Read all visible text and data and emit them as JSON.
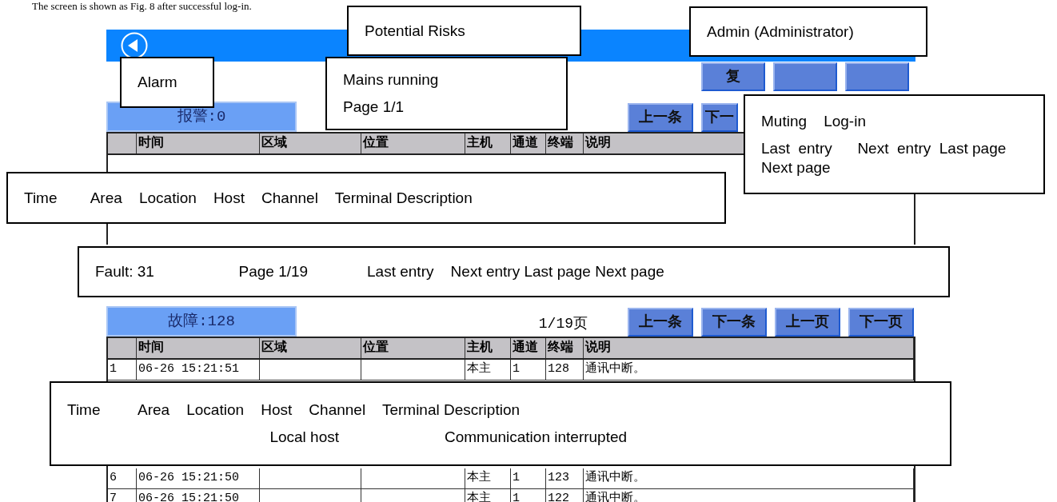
{
  "caption": "The screen is shown as Fig. 8 after successful log-in.",
  "top_buttons": [
    {
      "kind": "labeled",
      "label": "复"
    },
    {
      "kind": "covered"
    },
    {
      "kind": "covered"
    }
  ],
  "alarm_panel": {
    "label": "报警:0",
    "nav_buttons": [
      "上一条",
      "下一"
    ],
    "columns": [
      "",
      "时间",
      "区域",
      "位置",
      "主机",
      "通道",
      "终端",
      "说明"
    ]
  },
  "fault_panel": {
    "label": "故障:128",
    "page": "1/19页",
    "nav_buttons": [
      "上一条",
      "下一条",
      "上一页",
      "下一页"
    ],
    "columns": [
      "",
      "时间",
      "区域",
      "位置",
      "主机",
      "通道",
      "终端",
      "说明"
    ],
    "rows": [
      {
        "cells": [
          "1",
          "06-26 15:21:51",
          "",
          "",
          "本主",
          "1",
          "128",
          "通讯中断。"
        ]
      },
      {
        "cells": [
          "6",
          "06-26 15:21:50",
          "",
          "",
          "本主",
          "1",
          "123",
          "通讯中断。"
        ]
      },
      {
        "cells": [
          "7",
          "06-26 15:21:50",
          "",
          "",
          "本主",
          "1",
          "122",
          "通讯中断。"
        ]
      }
    ]
  },
  "callouts": [
    {
      "lines": [
        "Potential Risks"
      ]
    },
    {
      "lines": [
        "Admin (Administrator)"
      ]
    },
    {
      "lines": [
        "Alarm"
      ]
    },
    {
      "lines": [
        "Mains running",
        "Page 1/1"
      ]
    },
    {
      "lines": [
        "Muting    Log-in",
        "Last  entry      Next  entry  Last page Next page"
      ]
    },
    {
      "lines": [
        "Time        Area    Location    Host    Channel    Terminal Description"
      ]
    },
    {
      "lines": [
        "Fault: 31                    Page 1/19              Last entry    Next entry Last page Next page"
      ]
    },
    {
      "lines": [
        "Time         Area    Location    Host    Channel    Terminal Description",
        "                                                Local host                         Communication interrupted"
      ]
    }
  ]
}
